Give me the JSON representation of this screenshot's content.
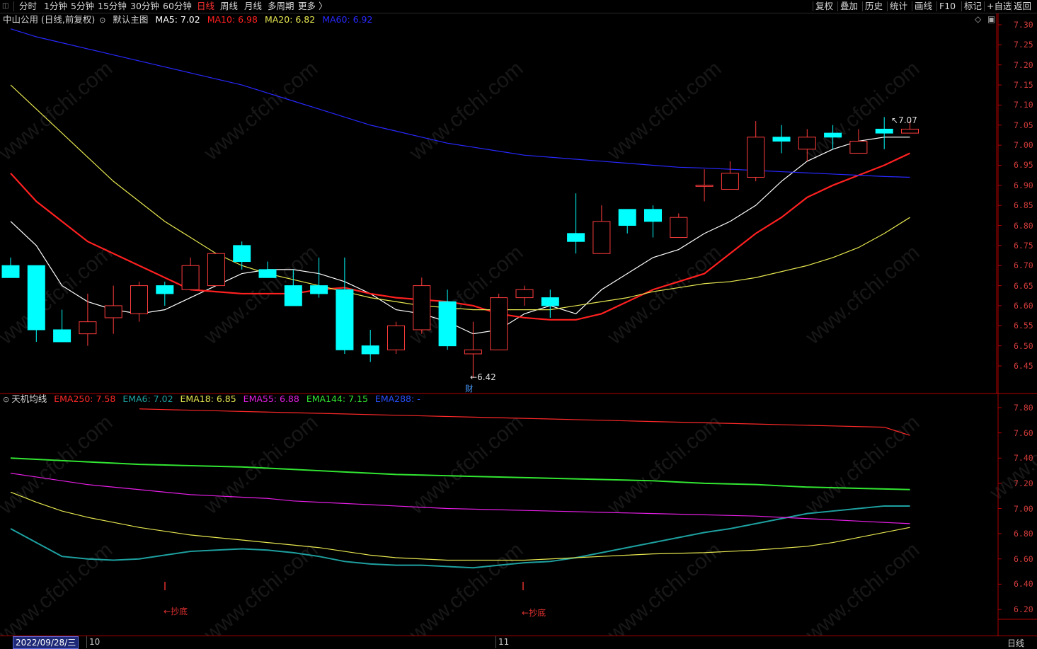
{
  "toolbar": {
    "periods": [
      "分时",
      "1分钟",
      "5分钟",
      "15分钟",
      "30分钟",
      "60分钟",
      "日线",
      "周线",
      "月线",
      "多周期",
      "更多 〉"
    ],
    "active_period": "日线",
    "right_buttons": [
      "复权",
      "叠加",
      "历史",
      "统计",
      "画线",
      "F10",
      "标记",
      "+自选",
      "返回"
    ]
  },
  "main_legend": {
    "title": "中山公用 (日线,前复权)",
    "template": "默认主图",
    "ma5": "MA5: 7.02",
    "ma10": "MA10: 6.98",
    "ma20": "MA20: 6.82",
    "ma60": "MA60: 6.92"
  },
  "sub_legend": {
    "title": "天机均线",
    "ema250": "EMA250: 7.58",
    "ema6": "EMA6: 7.02",
    "ema18": "EMA18: 6.85",
    "ema55": "EMA55: 6.88",
    "ema144": "EMA144: 7.15",
    "ema288": "EMA288: -"
  },
  "main_axis": [
    "7.30",
    "7.25",
    "7.20",
    "7.15",
    "7.10",
    "7.05",
    "7.00",
    "6.95",
    "6.90",
    "6.85",
    "6.80",
    "6.75",
    "6.70",
    "6.65",
    "6.60",
    "6.55",
    "6.50",
    "6.45"
  ],
  "sub_axis": [
    "7.80",
    "7.60",
    "7.40",
    "7.20",
    "7.00",
    "6.80",
    "6.60",
    "6.40",
    "6.20"
  ],
  "annotations": {
    "high": "7.07",
    "low": "6.42",
    "cai": "财",
    "signal1": "抄底",
    "signal2": "抄底"
  },
  "bottom": {
    "date": "2022/09/28/三",
    "m10": "10",
    "m11": "11",
    "period": "日线"
  },
  "watermark": "www.cfchi.com",
  "colors": {
    "up": "#ff3c3c",
    "down": "#00ffff",
    "ma5": "#ffffff",
    "ma10": "#ff2020",
    "ma20": "#e6e650",
    "ma60": "#2828ff"
  },
  "chart_data": [
    {
      "type": "candlestick",
      "title": "中山公用 (日线,前复权)",
      "ylim": [
        6.4,
        7.32
      ],
      "candles": [
        {
          "o": 6.7,
          "h": 6.72,
          "l": 6.67,
          "c": 6.67
        },
        {
          "o": 6.7,
          "h": 6.7,
          "l": 6.51,
          "c": 6.54
        },
        {
          "o": 6.54,
          "h": 6.59,
          "l": 6.51,
          "c": 6.51
        },
        {
          "o": 6.53,
          "h": 6.63,
          "l": 6.5,
          "c": 6.56
        },
        {
          "o": 6.57,
          "h": 6.65,
          "l": 6.53,
          "c": 6.6
        },
        {
          "o": 6.58,
          "h": 6.66,
          "l": 6.56,
          "c": 6.65
        },
        {
          "o": 6.65,
          "h": 6.66,
          "l": 6.6,
          "c": 6.63
        },
        {
          "o": 6.64,
          "h": 6.72,
          "l": 6.64,
          "c": 6.7
        },
        {
          "o": 6.65,
          "h": 6.73,
          "l": 6.65,
          "c": 6.73
        },
        {
          "o": 6.75,
          "h": 6.76,
          "l": 6.69,
          "c": 6.71
        },
        {
          "o": 6.69,
          "h": 6.71,
          "l": 6.67,
          "c": 6.67
        },
        {
          "o": 6.65,
          "h": 6.69,
          "l": 6.6,
          "c": 6.6
        },
        {
          "o": 6.65,
          "h": 6.72,
          "l": 6.62,
          "c": 6.63
        },
        {
          "o": 6.64,
          "h": 6.72,
          "l": 6.48,
          "c": 6.49
        },
        {
          "o": 6.5,
          "h": 6.54,
          "l": 6.46,
          "c": 6.48
        },
        {
          "o": 6.49,
          "h": 6.56,
          "l": 6.48,
          "c": 6.55
        },
        {
          "o": 6.54,
          "h": 6.67,
          "l": 6.53,
          "c": 6.65
        },
        {
          "o": 6.61,
          "h": 6.64,
          "l": 6.49,
          "c": 6.5
        },
        {
          "o": 6.48,
          "h": 6.56,
          "l": 6.42,
          "c": 6.49
        },
        {
          "o": 6.49,
          "h": 6.63,
          "l": 6.49,
          "c": 6.62
        },
        {
          "o": 6.62,
          "h": 6.65,
          "l": 6.6,
          "c": 6.64
        },
        {
          "o": 6.62,
          "h": 6.64,
          "l": 6.57,
          "c": 6.6
        },
        {
          "o": 6.78,
          "h": 6.88,
          "l": 6.73,
          "c": 6.76
        },
        {
          "o": 6.73,
          "h": 6.85,
          "l": 6.73,
          "c": 6.81
        },
        {
          "o": 6.84,
          "h": 6.84,
          "l": 6.78,
          "c": 6.8
        },
        {
          "o": 6.84,
          "h": 6.85,
          "l": 6.77,
          "c": 6.81
        },
        {
          "o": 6.77,
          "h": 6.83,
          "l": 6.77,
          "c": 6.82
        },
        {
          "o": 6.9,
          "h": 6.94,
          "l": 6.86,
          "c": 6.9
        },
        {
          "o": 6.89,
          "h": 6.96,
          "l": 6.89,
          "c": 6.93
        },
        {
          "o": 6.92,
          "h": 7.06,
          "l": 6.91,
          "c": 7.02
        },
        {
          "o": 7.02,
          "h": 7.05,
          "l": 6.98,
          "c": 7.01
        },
        {
          "o": 6.99,
          "h": 7.04,
          "l": 6.96,
          "c": 7.02
        },
        {
          "o": 7.03,
          "h": 7.05,
          "l": 6.99,
          "c": 7.02
        },
        {
          "o": 6.98,
          "h": 7.04,
          "l": 6.98,
          "c": 7.01
        },
        {
          "o": 7.04,
          "h": 7.07,
          "l": 6.99,
          "c": 7.03
        },
        {
          "o": 7.03,
          "h": 7.06,
          "l": 7.03,
          "c": 7.04
        }
      ],
      "series": [
        {
          "name": "MA5",
          "color": "#ffffff",
          "values": [
            6.81,
            6.75,
            6.65,
            6.61,
            6.59,
            6.58,
            6.59,
            6.62,
            6.65,
            6.68,
            6.69,
            6.69,
            6.68,
            6.66,
            6.63,
            6.59,
            6.58,
            6.56,
            6.53,
            6.54,
            6.58,
            6.6,
            6.58,
            6.64,
            6.68,
            6.72,
            6.74,
            6.78,
            6.81,
            6.85,
            6.91,
            6.96,
            6.99,
            7.01,
            7.02,
            7.02
          ]
        },
        {
          "name": "MA10",
          "color": "#ff2020",
          "values": [
            6.93,
            6.86,
            6.81,
            6.76,
            6.73,
            6.7,
            6.67,
            6.64,
            6.635,
            6.63,
            6.63,
            6.63,
            6.64,
            6.645,
            6.63,
            6.62,
            6.615,
            6.61,
            6.6,
            6.58,
            6.57,
            6.565,
            6.565,
            6.58,
            6.61,
            6.64,
            6.66,
            6.68,
            6.73,
            6.78,
            6.82,
            6.87,
            6.9,
            6.925,
            6.95,
            6.98
          ]
        },
        {
          "name": "MA20",
          "color": "#e6e650",
          "values": [
            7.15,
            7.09,
            7.03,
            6.97,
            6.91,
            6.86,
            6.81,
            6.77,
            6.73,
            6.7,
            6.68,
            6.665,
            6.65,
            6.635,
            6.62,
            6.61,
            6.6,
            6.595,
            6.59,
            6.59,
            6.59,
            6.59,
            6.6,
            6.61,
            6.62,
            6.635,
            6.645,
            6.655,
            6.66,
            6.67,
            6.685,
            6.7,
            6.72,
            6.745,
            6.78,
            6.82
          ]
        },
        {
          "name": "MA60",
          "color": "#2828ff",
          "values": [
            7.29,
            7.27,
            7.255,
            7.24,
            7.225,
            7.21,
            7.195,
            7.18,
            7.165,
            7.15,
            7.13,
            7.11,
            7.09,
            7.07,
            7.05,
            7.035,
            7.02,
            7.005,
            6.995,
            6.985,
            6.975,
            6.97,
            6.965,
            6.96,
            6.955,
            6.95,
            6.945,
            6.943,
            6.94,
            6.937,
            6.934,
            6.931,
            6.928,
            6.925,
            6.922,
            6.92
          ]
        }
      ]
    },
    {
      "type": "line",
      "title": "天机均线",
      "ylim": [
        6.1,
        7.9
      ],
      "series": [
        {
          "name": "EMA250",
          "color": "#ff2828",
          "values": [
            null,
            null,
            null,
            null,
            null,
            7.79,
            7.785,
            7.78,
            7.775,
            7.77,
            7.765,
            7.76,
            7.755,
            7.75,
            7.745,
            7.74,
            7.735,
            7.73,
            7.725,
            7.72,
            7.715,
            7.71,
            7.705,
            7.7,
            7.695,
            7.69,
            7.685,
            7.68,
            7.675,
            7.67,
            7.665,
            7.66,
            7.655,
            7.65,
            7.645,
            7.58
          ]
        },
        {
          "name": "EMA6",
          "color": "#1ea0a0",
          "values": [
            6.84,
            6.73,
            6.62,
            6.6,
            6.59,
            6.6,
            6.63,
            6.66,
            6.67,
            6.68,
            6.67,
            6.65,
            6.62,
            6.58,
            6.56,
            6.55,
            6.55,
            6.54,
            6.53,
            6.55,
            6.57,
            6.58,
            6.61,
            6.65,
            6.69,
            6.73,
            6.77,
            6.81,
            6.84,
            6.88,
            6.92,
            6.96,
            6.98,
            7.0,
            7.02,
            7.02
          ]
        },
        {
          "name": "EMA18",
          "color": "#e6e650",
          "values": [
            7.13,
            7.05,
            6.98,
            6.93,
            6.89,
            6.85,
            6.82,
            6.79,
            6.77,
            6.75,
            6.73,
            6.71,
            6.69,
            6.66,
            6.63,
            6.61,
            6.6,
            6.59,
            6.59,
            6.59,
            6.59,
            6.6,
            6.61,
            6.62,
            6.63,
            6.64,
            6.645,
            6.65,
            6.66,
            6.67,
            6.685,
            6.7,
            6.73,
            6.77,
            6.81,
            6.85
          ]
        },
        {
          "name": "EMA55",
          "color": "#e61ee6",
          "values": [
            7.28,
            7.25,
            7.22,
            7.19,
            7.17,
            7.15,
            7.13,
            7.11,
            7.1,
            7.09,
            7.08,
            7.06,
            7.05,
            7.04,
            7.03,
            7.02,
            7.01,
            7.0,
            6.995,
            6.99,
            6.985,
            6.98,
            6.975,
            6.97,
            6.965,
            6.96,
            6.955,
            6.95,
            6.945,
            6.94,
            6.93,
            6.92,
            6.91,
            6.9,
            6.89,
            6.88
          ]
        },
        {
          "name": "EMA144",
          "color": "#32e632",
          "values": [
            7.4,
            7.39,
            7.38,
            7.37,
            7.36,
            7.35,
            7.345,
            7.34,
            7.335,
            7.33,
            7.32,
            7.31,
            7.3,
            7.29,
            7.28,
            7.27,
            7.265,
            7.26,
            7.255,
            7.25,
            7.245,
            7.24,
            7.235,
            7.23,
            7.225,
            7.22,
            7.21,
            7.2,
            7.195,
            7.19,
            7.18,
            7.17,
            7.165,
            7.16,
            7.155,
            7.15
          ]
        }
      ],
      "signals": [
        {
          "index": 6,
          "label": "抄底"
        },
        {
          "index": 20,
          "label": "抄底"
        }
      ]
    }
  ]
}
